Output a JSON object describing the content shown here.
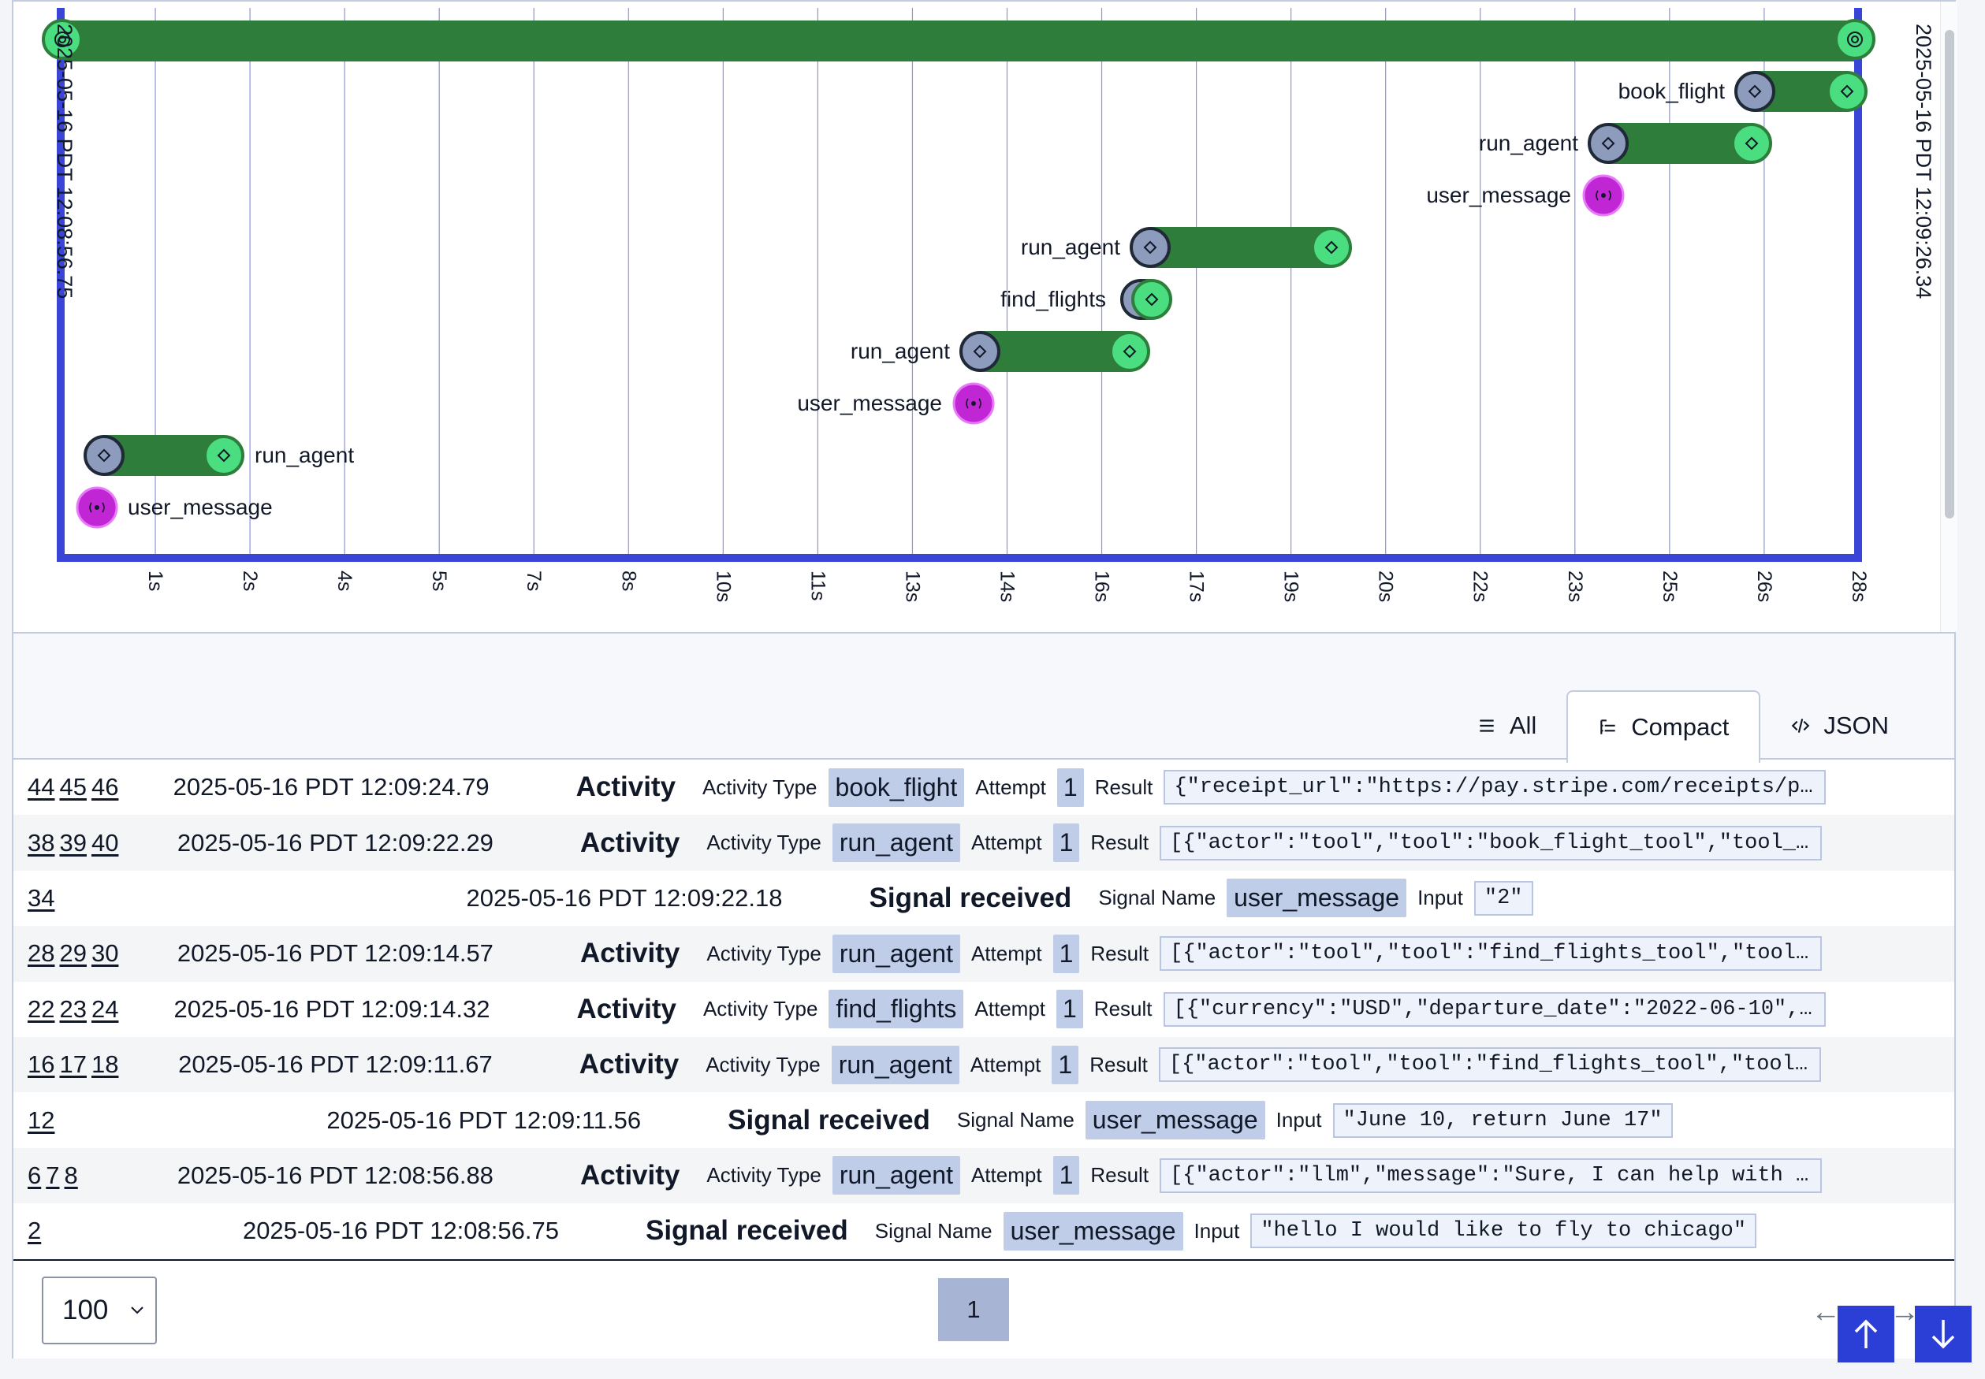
{
  "timeline": {
    "start_label": "2025-05-16 PDT 12:08:56.75",
    "end_label": "2025-05-16 PDT 12:09:26.34",
    "ticks": [
      "1s",
      "2s",
      "4s",
      "5s",
      "7s",
      "8s",
      "10s",
      "11s",
      "13s",
      "14s",
      "16s",
      "17s",
      "19s",
      "20s",
      "22s",
      "23s",
      "25s",
      "26s",
      "28s"
    ],
    "lanes": [
      {
        "label": "book_flight"
      },
      {
        "label": "run_agent"
      },
      {
        "label": "user_message"
      },
      {
        "label": "run_agent"
      },
      {
        "label": "find_flights"
      },
      {
        "label": "run_agent"
      },
      {
        "label": "user_message"
      },
      {
        "label": "run_agent"
      },
      {
        "label": "user_message"
      }
    ],
    "colors": {
      "workflow_bar": "#2e7d3a",
      "axis": "#3a45d8",
      "grid": "#8a94e0",
      "start_node": "#8d9bbd",
      "end_node": "#4ade80",
      "signal_node": "#c026d3"
    }
  },
  "tabs": [
    {
      "label": "All",
      "icon": "list-icon"
    },
    {
      "label": "Compact",
      "icon": "tree-icon"
    },
    {
      "label": "JSON",
      "icon": "code-icon"
    }
  ],
  "events": [
    {
      "ids": [
        "44",
        "45",
        "46"
      ],
      "time": "2025-05-16 PDT 12:09:24.79",
      "type": "Activity",
      "k1": "Activity Type",
      "v1": "book_flight",
      "k2": "Attempt",
      "v2": "1",
      "k3": "Result",
      "v3": "{\"receipt_url\":\"https://pay.stripe.com/receipts/pa…"
    },
    {
      "ids": [
        "38",
        "39",
        "40"
      ],
      "time": "2025-05-16 PDT 12:09:22.29",
      "type": "Activity",
      "k1": "Activity Type",
      "v1": "run_agent",
      "k2": "Attempt",
      "v2": "1",
      "k3": "Result",
      "v3": "[{\"actor\":\"tool\",\"tool\":\"book_flight_tool\",\"tool_i…"
    },
    {
      "ids": [
        "34"
      ],
      "time": "2025-05-16 PDT 12:09:22.18",
      "type": "Signal received",
      "k1": "Signal Name",
      "v1": "user_message",
      "k3": "Input",
      "v3": "\"2\""
    },
    {
      "ids": [
        "28",
        "29",
        "30"
      ],
      "time": "2025-05-16 PDT 12:09:14.57",
      "type": "Activity",
      "k1": "Activity Type",
      "v1": "run_agent",
      "k2": "Attempt",
      "v2": "1",
      "k3": "Result",
      "v3": "[{\"actor\":\"tool\",\"tool\":\"find_flights_tool\",\"tool_…"
    },
    {
      "ids": [
        "22",
        "23",
        "24"
      ],
      "time": "2025-05-16 PDT 12:09:14.32",
      "type": "Activity",
      "k1": "Activity Type",
      "v1": "find_flights",
      "k2": "Attempt",
      "v2": "1",
      "k3": "Result",
      "v3": "[{\"currency\":\"USD\",\"departure_date\":\"2022-06-10\",\"…"
    },
    {
      "ids": [
        "16",
        "17",
        "18"
      ],
      "time": "2025-05-16 PDT 12:09:11.67",
      "type": "Activity",
      "k1": "Activity Type",
      "v1": "run_agent",
      "k2": "Attempt",
      "v2": "1",
      "k3": "Result",
      "v3": "[{\"actor\":\"tool\",\"tool\":\"find_flights_tool\",\"tool_…"
    },
    {
      "ids": [
        "12"
      ],
      "time": "2025-05-16 PDT 12:09:11.56",
      "type": "Signal received",
      "k1": "Signal Name",
      "v1": "user_message",
      "k3": "Input",
      "v3": "\"June 10, return June 17\""
    },
    {
      "ids": [
        "6",
        "7",
        "8"
      ],
      "time": "2025-05-16 PDT 12:08:56.88",
      "type": "Activity",
      "k1": "Activity Type",
      "v1": "run_agent",
      "k2": "Attempt",
      "v2": "1",
      "k3": "Result",
      "v3": "[{\"actor\":\"llm\",\"message\":\"Sure, I can help with t…"
    },
    {
      "ids": [
        "2"
      ],
      "time": "2025-05-16 PDT 12:08:56.75",
      "type": "Signal received",
      "k1": "Signal Name",
      "v1": "user_message",
      "k3": "Input",
      "v3": "\"hello I would like to fly to chicago\""
    }
  ],
  "footer": {
    "page_size": "100",
    "page_number": "1",
    "prev_symbol": "←",
    "next_symbol": "→"
  }
}
